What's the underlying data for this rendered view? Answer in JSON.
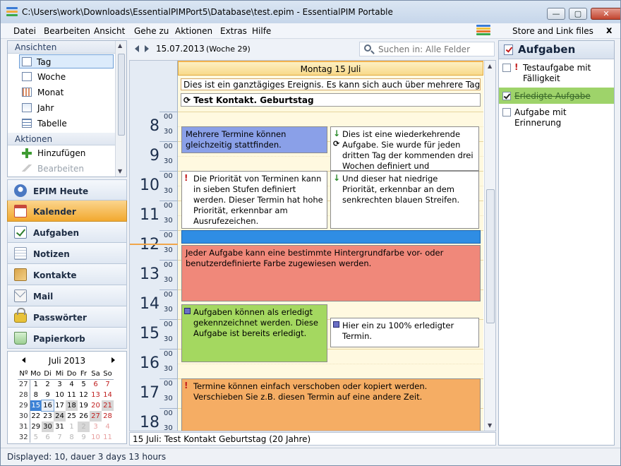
{
  "window": {
    "title": "C:\\Users\\work\\Downloads\\EssentialPIMPort5\\Database\\test.epim - EssentialPIM Portable",
    "min_glyph": "—",
    "max_glyph": "▢",
    "close_glyph": "✕"
  },
  "menu": {
    "items": [
      "Datei",
      "Bearbeiten",
      "Ansicht",
      "Gehe zu",
      "Aktionen",
      "Extras",
      "Hilfe"
    ],
    "store_link": "Store and Link files",
    "store_close": "x"
  },
  "views": {
    "header": "Ansichten",
    "items": [
      "Tag",
      "Woche",
      "Monat",
      "Jahr",
      "Tabelle"
    ],
    "selected": "Tag"
  },
  "actions": {
    "header": "Aktionen",
    "add": "Hinzufügen",
    "edit": "Bearbeiten"
  },
  "modules": {
    "items": [
      "EPIM Heute",
      "Kalender",
      "Aufgaben",
      "Notizen",
      "Kontakte",
      "Mail",
      "Passwörter",
      "Papierkorb"
    ],
    "active": "Kalender"
  },
  "minical": {
    "month_label": "Juli  2013",
    "weekday_header": [
      "Nº",
      "Mo",
      "Di",
      "Mi",
      "Do",
      "Fr",
      "Sa",
      "So"
    ],
    "weeks": [
      [
        "27",
        "1",
        "2",
        "3",
        "4",
        "5",
        "6",
        "7"
      ],
      [
        "28",
        "8",
        "9",
        "10",
        "11",
        "12",
        "13",
        "14"
      ],
      [
        "29",
        "15",
        "16",
        "17",
        "18",
        "19",
        "20",
        "21"
      ],
      [
        "30",
        "22",
        "23",
        "24",
        "25",
        "26",
        "27",
        "28"
      ],
      [
        "31",
        "29",
        "30",
        "31",
        "1",
        "2",
        "3",
        "4"
      ],
      [
        "32",
        "5",
        "6",
        "7",
        "8",
        "9",
        "10",
        "11"
      ]
    ]
  },
  "toolbar": {
    "date": "15.07.2013",
    "week": "(Woche 29)",
    "search_placeholder": "Suchen in: Alle Felder"
  },
  "day": {
    "header": "Montag 15 Juli",
    "allday_event": "Dies ist ein ganztägiges Ereignis. Es kann sich auch über mehrere Tage",
    "birthday_event": "Test Kontakt. Geburtstag",
    "hours": [
      "8",
      "9",
      "10",
      "11",
      "12",
      "13",
      "14",
      "15",
      "16",
      "17",
      "18"
    ],
    "minutes": [
      "00",
      "30"
    ]
  },
  "events": {
    "blue": "Mehrere Termine können gleichzeitig stattfinden.",
    "recurring": "Dies ist eine wiederkehrende Aufgabe. Sie wurde für jeden dritten Tag der kommenden drei Wochen definiert und automatisch",
    "priority_high": "Die Priorität von Terminen kann in sieben Stufen definiert werden. Dieser Termin hat hohe Priorität, erkennbar am Ausrufezeichen.",
    "priority_low": "Und dieser hat niedrige Priorität, erkennbar an dem senkrechten blauen Streifen.",
    "red": "Jeder Aufgabe kann eine bestimmte Hintergrundfarbe vor- oder benutzerdefinierte Farbe zugewiesen werden.",
    "green": "Aufgaben können als erledigt gekennzeichnet werden. Diese Aufgabe ist bereits erledigt.",
    "completed": "Hier ein zu 100% erledigter Termin.",
    "orange": "Termine können einfach verschoben oder kopiert werden. Verschieben Sie z.B. diesen Termin auf eine andere Zeit."
  },
  "event_colors": {
    "blue": "#8aa0e8",
    "bar": "#2f8de4",
    "red": "#f0887a",
    "green": "#a4d860",
    "orange": "#f5ad64"
  },
  "cal_status": "15 Juli:  Test Kontakt Geburtstag  (20 Jahre)",
  "tasks": {
    "header": "Aufgaben",
    "items": [
      {
        "label": "Testaufgabe mit Fälligkeit",
        "priority": "!",
        "checked": false
      },
      {
        "label": "Erledigte Aufgabe",
        "checked": true
      },
      {
        "label": "Aufgabe mit Erinnerung",
        "checked": false
      }
    ]
  },
  "status_bar": "Displayed: 10, dauer 3 days 13 hours"
}
